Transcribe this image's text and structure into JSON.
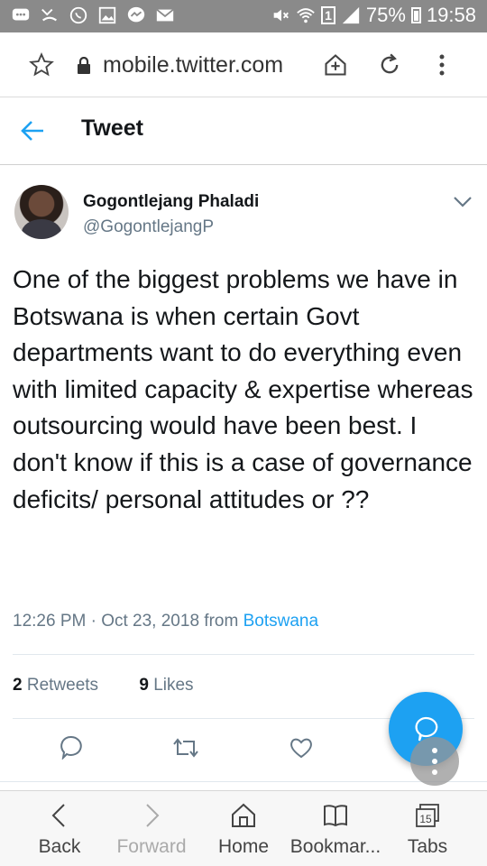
{
  "status_bar": {
    "battery": "75%",
    "time": "19:58",
    "sim": "1",
    "icons": [
      "chat-bubble-icon",
      "missed-call-icon",
      "whatsapp-icon",
      "image-icon",
      "messenger-icon",
      "mail-icon",
      "mute-icon",
      "wifi-icon",
      "signal-icon",
      "battery-icon"
    ]
  },
  "browser": {
    "url": "mobile.twitter.com"
  },
  "header": {
    "title": "Tweet"
  },
  "tweet": {
    "author_name": "Gogontlejang Phaladi",
    "author_handle": "@GogontlejangP",
    "text": "One of the biggest problems we have in Botswana is when certain Govt departments want to do everything even with limited capacity & expertise whereas outsourcing would have been best. I don't know if this is a case of governance deficits/ personal attitudes or ??",
    "time": "12:26 PM · Oct 23, 2018 from ",
    "location": "Botswana",
    "retweets_count": "2",
    "retweets_label": "Retweets",
    "likes_count": "9",
    "likes_label": "Likes"
  },
  "bottom_nav": {
    "back": "Back",
    "forward": "Forward",
    "home": "Home",
    "bookmarks": "Bookmar...",
    "tabs": "Tabs",
    "tabs_count": "15"
  },
  "colors": {
    "accent": "#1da1f2",
    "status_bar": "#8a8a8a",
    "secondary_text": "#657786"
  }
}
